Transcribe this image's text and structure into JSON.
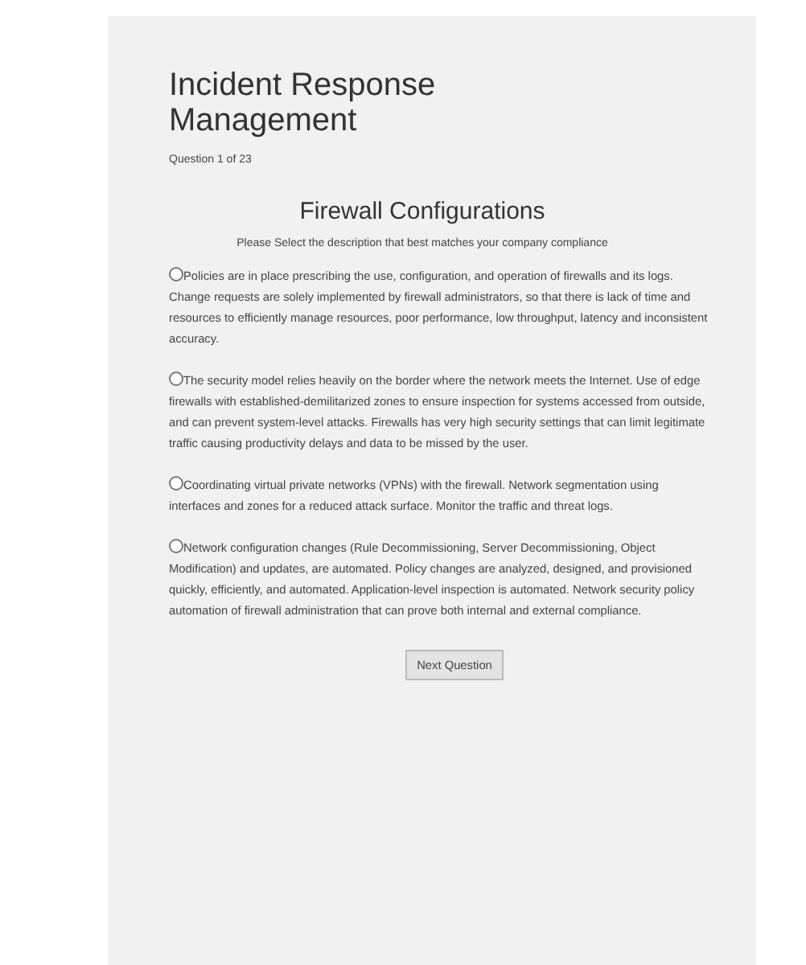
{
  "title": "Incident Response Management",
  "progress": "Question 1 of 23",
  "question": {
    "heading": "Firewall Configurations",
    "prompt": "Please Select the description that best matches your company compliance",
    "options": [
      {
        "text": "Policies are in place prescribing the use, configuration, and operation of firewalls and its logs. Change requests are solely implemented by firewall administrators, so that there is lack of time and resources to efficiently manage resources, poor performance, low throughput, latency and inconsistent accuracy.",
        "selected": false
      },
      {
        "text": "The security model relies heavily on the border where the network meets the Internet. Use of edge firewalls with established-demilitarized zones to ensure inspection for systems accessed from outside, and can prevent system-level attacks. Firewalls has very high security settings that can limit legitimate traffic causing productivity delays and data to be missed by the user.",
        "selected": false
      },
      {
        "text": "Coordinating virtual private networks (VPNs) with the firewall. Network segmentation using interfaces and zones for a reduced attack surface. Monitor the traffic and threat logs.",
        "selected": false
      },
      {
        "text": "Network configuration changes (Rule Decommissioning, Server Decommissioning, Object Modification) and updates, are automated. Policy changes are analyzed, designed, and provisioned quickly, efficiently, and automated. Application-level inspection is automated. Network security policy automation of firewall administration that can prove both internal and external compliance.",
        "selected": false
      }
    ]
  },
  "next_button": "Next Question"
}
